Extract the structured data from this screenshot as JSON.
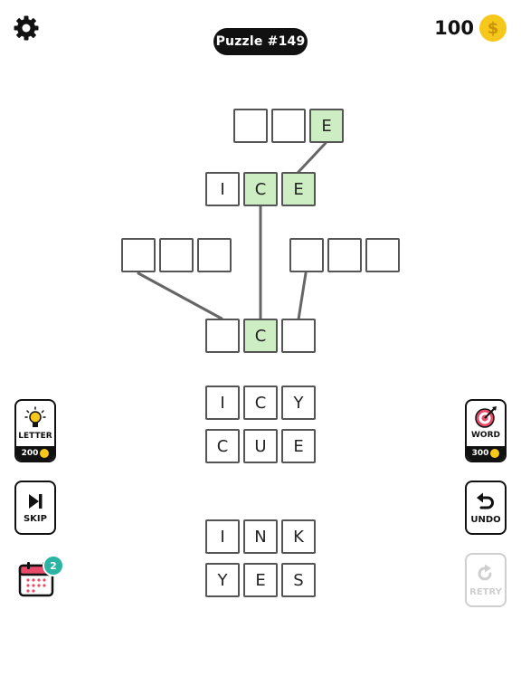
{
  "header": {
    "puzzle_label": "Puzzle #149",
    "coin_count": "100",
    "coin_symbol": "$"
  },
  "board": {
    "top_word": [
      "",
      "",
      "E"
    ],
    "ice_word": [
      "I",
      "C",
      "E"
    ],
    "left_word": [
      "",
      "",
      ""
    ],
    "right_word": [
      "",
      "",
      ""
    ],
    "center_word": [
      "",
      "C",
      ""
    ]
  },
  "word_bank": {
    "group_1": [
      [
        "I",
        "C",
        "Y"
      ],
      [
        "C",
        "U",
        "E"
      ]
    ],
    "group_2": [
      [
        "I",
        "N",
        "K"
      ],
      [
        "Y",
        "E",
        "S"
      ]
    ]
  },
  "buttons": {
    "letter": {
      "label": "LETTER",
      "price": "200"
    },
    "word": {
      "label": "WORD",
      "price": "300"
    },
    "skip": {
      "label": "SKIP"
    },
    "undo": {
      "label": "UNDO"
    },
    "retry": {
      "label": "RETRY"
    },
    "calendar_badge": "2"
  },
  "colors": {
    "solved_tile": "#cdeec3",
    "coin": "#f7c81c",
    "badge": "#2bb3a3",
    "pill": "#111111"
  }
}
